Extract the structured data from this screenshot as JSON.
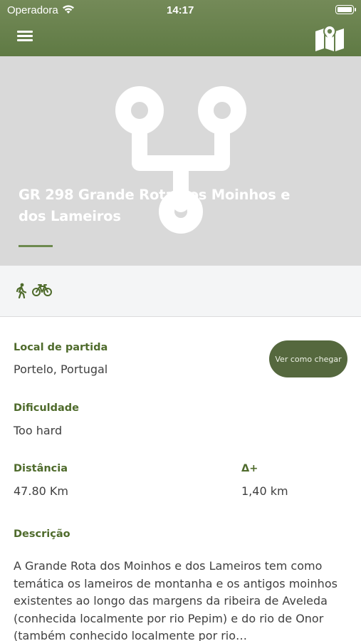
{
  "status_bar": {
    "carrier": "Operadora",
    "time": "14:17"
  },
  "header": {
    "menu_icon": "hamburger-menu-icon",
    "map_icon": "folded-map-icon"
  },
  "hero": {
    "title": "GR 298 Grande Rota dos Moinhos e dos Lameiros",
    "placeholder_icon": "route-path-icon"
  },
  "activity_types": [
    {
      "icon": "walking-icon"
    },
    {
      "icon": "bicycle-icon"
    }
  ],
  "details": {
    "start_label": "Local de partida",
    "start_value": "Portelo, Portugal",
    "directions_button": "Ver como chegar",
    "difficulty_label": "Dificuldade",
    "difficulty_value": "Too hard",
    "distance_label": "Distância",
    "distance_value": "47.80 Km",
    "elevation_label": "Δ+",
    "elevation_value": "1,40 km",
    "description_label": "Descrição",
    "description_text": "A Grande Rota dos Moinhos e dos Lameiros tem como temática os lameiros de montanha e os antigos moinhos existentes ao longo das margens da ribeira de Aveleda (conhecida localmente por rio Pepim) e do rio de Onor (também conhecido localmente por rio…"
  },
  "colors": {
    "brand_green": "#5f7a44",
    "label_green": "#4f6b2c",
    "hero_gray": "#d9d9d9"
  }
}
